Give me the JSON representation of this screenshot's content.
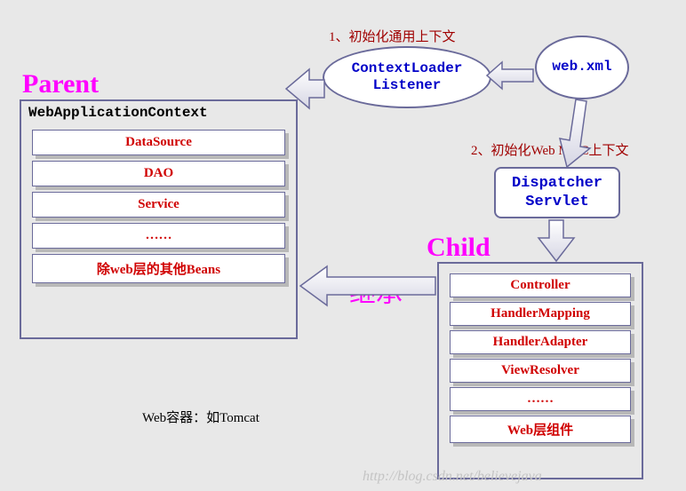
{
  "parent": {
    "title": "Parent",
    "header": "WebApplicationContext",
    "beans": [
      "DataSource",
      "DAO",
      "Service",
      "……",
      "除web层的其他Beans"
    ]
  },
  "child": {
    "title": "Child",
    "beans": [
      "Controller",
      "HandlerMapping",
      "HandlerAdapter",
      "ViewResolver",
      "……",
      "Web层组件"
    ]
  },
  "nodes": {
    "webxml": "web.xml",
    "contextLoaderListener": "ContextLoader\nListener",
    "dispatcherServlet": "Dispatcher\nServlet"
  },
  "labels": {
    "step1": "1、初始化通用上下文",
    "step2": "2、初始化Web MVC上下文",
    "inherit": "继承",
    "footer": "Web容器：如Tomcat"
  },
  "watermark": "http://blog.csdn.net/believejava",
  "colors": {
    "magenta": "#ff00ff",
    "boxBorder": "#6a6a9a",
    "red": "#d00000",
    "blue": "#0000c8"
  }
}
